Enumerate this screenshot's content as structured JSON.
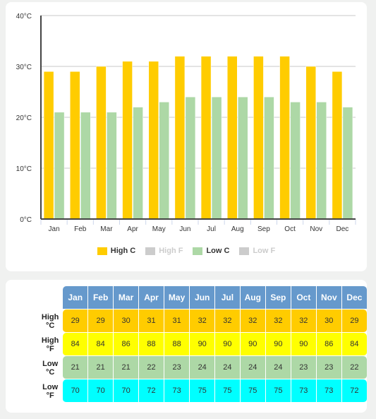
{
  "chart_data": {
    "type": "bar",
    "title": "",
    "xlabel": "",
    "ylabel": "",
    "categories": [
      "Jan",
      "Feb",
      "Mar",
      "Apr",
      "May",
      "Jun",
      "Jul",
      "Aug",
      "Sep",
      "Oct",
      "Nov",
      "Dec"
    ],
    "series": [
      {
        "name": "High C",
        "color": "#ffcc00",
        "visible": true,
        "values": [
          29,
          29,
          30,
          31,
          31,
          32,
          32,
          32,
          32,
          32,
          30,
          29
        ]
      },
      {
        "name": "High F",
        "color": "#cccccc",
        "visible": false,
        "values": [
          84,
          84,
          86,
          88,
          88,
          90,
          90,
          90,
          90,
          90,
          86,
          84
        ]
      },
      {
        "name": "Low C",
        "color": "#add8a6",
        "visible": true,
        "values": [
          21,
          21,
          21,
          22,
          23,
          24,
          24,
          24,
          24,
          23,
          23,
          22
        ]
      },
      {
        "name": "Low F",
        "color": "#cccccc",
        "visible": false,
        "values": [
          70,
          70,
          70,
          72,
          73,
          75,
          75,
          75,
          75,
          73,
          73,
          72
        ]
      }
    ],
    "ylim": [
      0,
      40
    ],
    "yticks": [
      "0°C",
      "10°C",
      "20°C",
      "30°C",
      "40°C"
    ],
    "ytick_values": [
      0,
      10,
      20,
      30,
      40
    ],
    "grid": true,
    "legend_position": "bottom"
  },
  "legend": [
    {
      "label": "High C",
      "color": "#ffcc00",
      "text_color": "#333333"
    },
    {
      "label": "High F",
      "color": "#cccccc",
      "text_color": "#cccccc"
    },
    {
      "label": "Low C",
      "color": "#add8a6",
      "text_color": "#333333"
    },
    {
      "label": "Low F",
      "color": "#cccccc",
      "text_color": "#cccccc"
    }
  ],
  "table": {
    "months": [
      "Jan",
      "Feb",
      "Mar",
      "Apr",
      "May",
      "Jun",
      "Jul",
      "Aug",
      "Sep",
      "Oct",
      "Nov",
      "Dec"
    ],
    "rows": [
      {
        "label1": "High",
        "label2": "°C",
        "values": [
          "29",
          "29",
          "30",
          "31",
          "31",
          "32",
          "32",
          "32",
          "32",
          "32",
          "30",
          "29"
        ]
      },
      {
        "label1": "High",
        "label2": "°F",
        "values": [
          "84",
          "84",
          "86",
          "88",
          "88",
          "90",
          "90",
          "90",
          "90",
          "90",
          "86",
          "84"
        ]
      },
      {
        "label1": "Low",
        "label2": "°C",
        "values": [
          "21",
          "21",
          "21",
          "22",
          "23",
          "24",
          "24",
          "24",
          "24",
          "23",
          "23",
          "22"
        ]
      },
      {
        "label1": "Low",
        "label2": "°F",
        "values": [
          "70",
          "70",
          "70",
          "72",
          "73",
          "75",
          "75",
          "75",
          "75",
          "73",
          "73",
          "72"
        ]
      }
    ]
  }
}
